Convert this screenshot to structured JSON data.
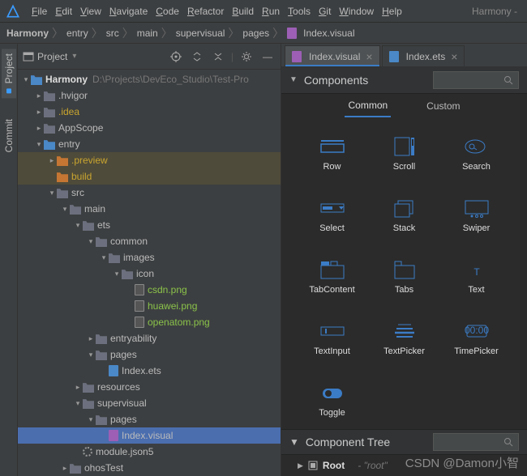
{
  "menu": {
    "items": [
      "File",
      "Edit",
      "View",
      "Navigate",
      "Code",
      "Refactor",
      "Build",
      "Run",
      "Tools",
      "Git",
      "Window",
      "Help"
    ],
    "project": "Harmony -"
  },
  "breadcrumb": [
    "Harmony",
    "entry",
    "src",
    "main",
    "supervisual",
    "pages",
    "Index.visual"
  ],
  "panel": {
    "title": "Project"
  },
  "tree": [
    {
      "d": 0,
      "a": "down",
      "ico": "module",
      "lbl": "Harmony",
      "bold": true,
      "dim": "D:\\Projects\\DevEco_Studio\\Test-Pro"
    },
    {
      "d": 1,
      "a": "right",
      "ico": "folder",
      "lbl": ".hvigor"
    },
    {
      "d": 1,
      "a": "right",
      "ico": "folder",
      "lbl": ".idea",
      "cls": "yellow"
    },
    {
      "d": 1,
      "a": "right",
      "ico": "folder",
      "lbl": "AppScope"
    },
    {
      "d": 1,
      "a": "down",
      "ico": "folderblue",
      "lbl": "entry"
    },
    {
      "d": 2,
      "a": "right",
      "ico": "folderorange",
      "lbl": ".preview",
      "cls": "yellow",
      "hl": true
    },
    {
      "d": 2,
      "a": "blank",
      "ico": "folderorange",
      "lbl": "build",
      "cls": "yellow",
      "hl": true
    },
    {
      "d": 2,
      "a": "down",
      "ico": "folder",
      "lbl": "src"
    },
    {
      "d": 3,
      "a": "down",
      "ico": "folder",
      "lbl": "main"
    },
    {
      "d": 4,
      "a": "down",
      "ico": "folder",
      "lbl": "ets"
    },
    {
      "d": 5,
      "a": "down",
      "ico": "folder",
      "lbl": "common"
    },
    {
      "d": 6,
      "a": "down",
      "ico": "folder",
      "lbl": "images"
    },
    {
      "d": 7,
      "a": "down",
      "ico": "folder",
      "lbl": "icon"
    },
    {
      "d": 8,
      "a": "blank",
      "ico": "file",
      "lbl": "csdn.png",
      "cls": "green"
    },
    {
      "d": 8,
      "a": "blank",
      "ico": "file",
      "lbl": "huawei.png",
      "cls": "green"
    },
    {
      "d": 8,
      "a": "blank",
      "ico": "file",
      "lbl": "openatom.png",
      "cls": "green"
    },
    {
      "d": 5,
      "a": "right",
      "ico": "folder",
      "lbl": "entryability"
    },
    {
      "d": 5,
      "a": "down",
      "ico": "folder",
      "lbl": "pages"
    },
    {
      "d": 6,
      "a": "blank",
      "ico": "ets",
      "lbl": "Index.ets"
    },
    {
      "d": 4,
      "a": "right",
      "ico": "folder",
      "lbl": "resources"
    },
    {
      "d": 4,
      "a": "down",
      "ico": "folder",
      "lbl": "supervisual"
    },
    {
      "d": 5,
      "a": "down",
      "ico": "folder",
      "lbl": "pages"
    },
    {
      "d": 6,
      "a": "blank",
      "ico": "vis",
      "lbl": "Index.visual",
      "sel": true
    },
    {
      "d": 4,
      "a": "blank",
      "ico": "gear",
      "lbl": "module.json5"
    },
    {
      "d": 3,
      "a": "right",
      "ico": "folder",
      "lbl": "ohosTest"
    }
  ],
  "editor": {
    "tabs": [
      {
        "lbl": "Index.visual",
        "ico": "vis",
        "active": true
      },
      {
        "lbl": "Index.ets",
        "ico": "ets",
        "active": false
      }
    ]
  },
  "components": {
    "title": "Components",
    "tabs": [
      "Common",
      "Custom"
    ],
    "items": [
      "Row",
      "Scroll",
      "Search",
      "Select",
      "Stack",
      "Swiper",
      "TabContent",
      "Tabs",
      "Text",
      "TextInput",
      "TextPicker",
      "TimePicker",
      "Toggle"
    ]
  },
  "componentTree": {
    "title": "Component Tree",
    "root": "Root",
    "rootVal": "- \"root\""
  },
  "gutter": {
    "project": "Project",
    "commit": "Commit"
  },
  "watermark": "CSDN @Damon小智"
}
